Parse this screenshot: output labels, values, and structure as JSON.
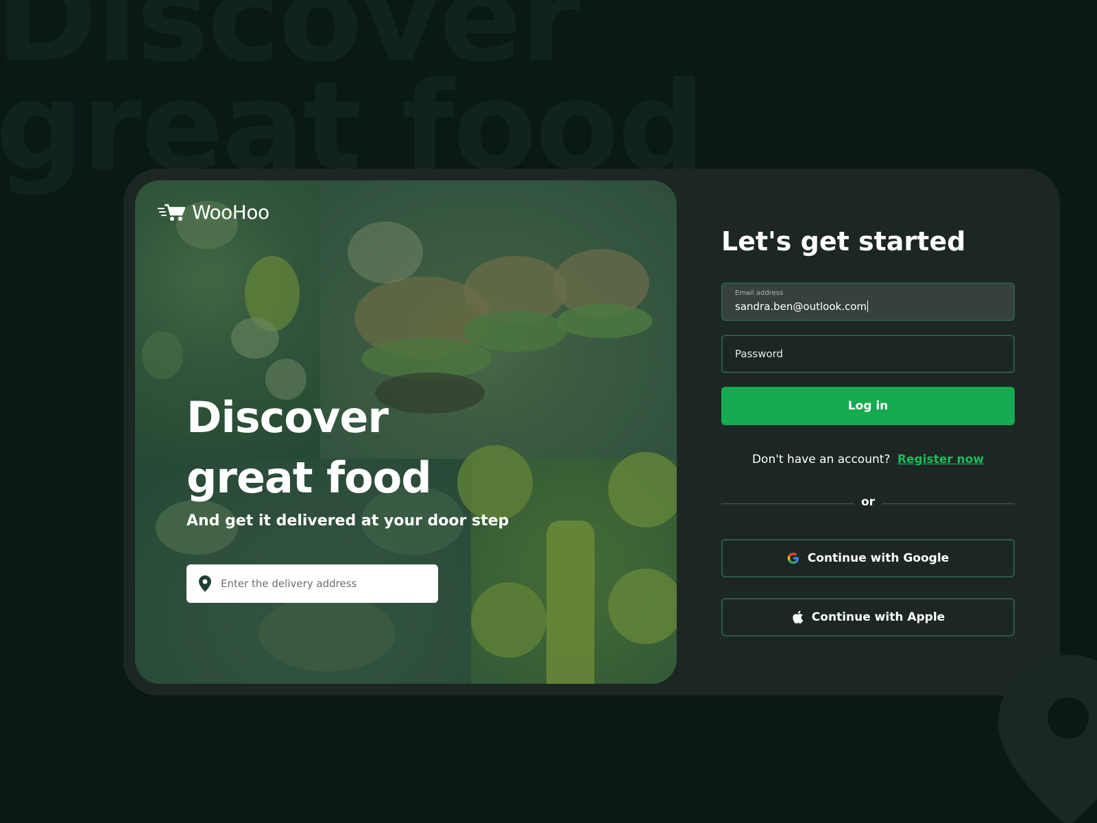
{
  "background": {
    "watermark_line1": "Discover",
    "watermark_line2": "great food"
  },
  "brand": {
    "name": "WooHoo"
  },
  "hero": {
    "headline_line1": "Discover",
    "headline_line2": "great food",
    "subheadline": "And get it delivered at your door step",
    "address_placeholder": "Enter the delivery address"
  },
  "login": {
    "title": "Let's get started",
    "email_label": "Email address",
    "email_value": "sandra.ben@outlook.com",
    "password_placeholder": "Password",
    "login_button": "Log in",
    "register_prompt": "Don't have an account?",
    "register_link": "Register now",
    "divider_text": "or",
    "google_button": "Continue with Google",
    "apple_button": "Continue with Apple"
  },
  "icons": {
    "logo": "cart-icon",
    "address": "location-pin-icon",
    "google": "google-icon",
    "apple": "apple-icon",
    "background_pin": "location-pin-icon"
  },
  "colors": {
    "page_background": "#0a1916",
    "card_background": "#1c2724",
    "accent_green": "#16aa51",
    "link_green": "#1bbd5a",
    "field_border": "#2d5a46"
  }
}
